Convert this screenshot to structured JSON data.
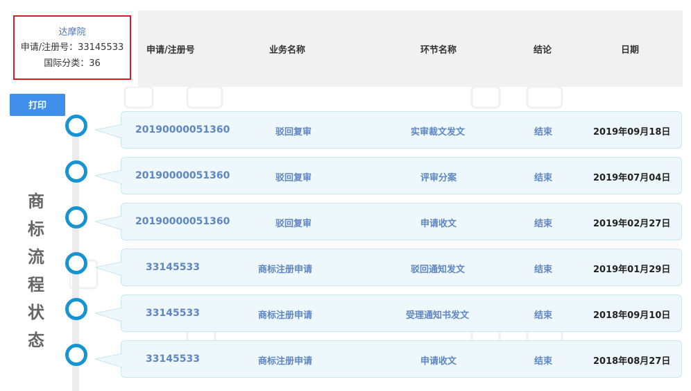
{
  "info": {
    "name": "达摩院",
    "reg_line": "申请/注册号：33145533",
    "class_line": "国际分类：36"
  },
  "header": {
    "col_reg": "申请/注册号",
    "col_biz": "业务名称",
    "col_step": "环节名称",
    "col_result": "结论",
    "col_date": "日期"
  },
  "print_label": "打印",
  "side_title": [
    "商",
    "标",
    "流",
    "程",
    "状",
    "态"
  ],
  "rows": [
    {
      "reg": "20190000051360",
      "biz": "驳回复审",
      "step": "实审裁文发文",
      "result": "结束",
      "date": "2019年09月18日"
    },
    {
      "reg": "20190000051360",
      "biz": "驳回复审",
      "step": "评审分案",
      "result": "结束",
      "date": "2019年07月04日"
    },
    {
      "reg": "20190000051360",
      "biz": "驳回复审",
      "step": "申请收文",
      "result": "结束",
      "date": "2019年02月27日"
    },
    {
      "reg": "33145533",
      "biz": "商标注册申请",
      "step": "驳回通知发文",
      "result": "结束",
      "date": "2019年01月29日"
    },
    {
      "reg": "33145533",
      "biz": "商标注册申请",
      "step": "受理通知书发文",
      "result": "结束",
      "date": "2018年09月10日"
    },
    {
      "reg": "33145533",
      "biz": "商标注册申请",
      "step": "申请收文",
      "result": "结束",
      "date": "2018年08月27日"
    }
  ],
  "colors": {
    "highlight_border": "#e0191f",
    "accent_blue": "#3f8fea",
    "node_blue": "#1794cf",
    "link_blue": "#5d86c2"
  }
}
